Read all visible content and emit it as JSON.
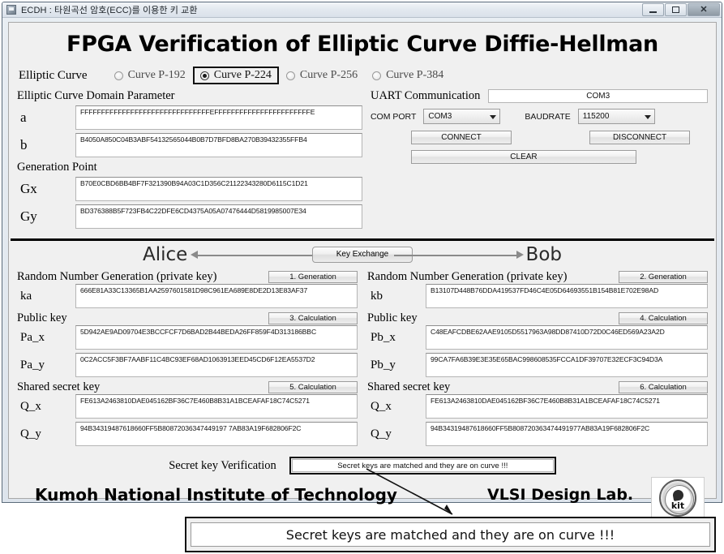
{
  "window": {
    "title": "ECDH : 타원곡선 암호(ECC)를 이용한 키 교환",
    "minimize_label": "",
    "maximize_label": "",
    "close_label": "✕"
  },
  "app": {
    "title": "FPGA Verification of Elliptic Curve Diffie-Hellman"
  },
  "curve_selector": {
    "label": "Elliptic Curve",
    "options": [
      {
        "label": "Curve P-192",
        "selected": false
      },
      {
        "label": "Curve P-224",
        "selected": true
      },
      {
        "label": "Curve P-256",
        "selected": false
      },
      {
        "label": "Curve P-384",
        "selected": false
      }
    ]
  },
  "domain_parameter": {
    "title": "Elliptic Curve Domain Parameter",
    "a_label": "a",
    "a_value": "FFFFFFFFFFFFFFFFFFFFFFFFFFFFFFFEFFFFFFFFFFFFFFFFFFFFFFFE",
    "b_label": "b",
    "b_value": "B4050A850C04B3ABF54132565044B0B7D7BFD8BA270B39432355FFB4"
  },
  "generation_point": {
    "title": "Generation Point",
    "gx_label": "Gx",
    "gx_value": "B70E0CBD6BB4BF7F321390B94A03C1D356C21122343280D6115C1D21",
    "gy_label": "Gy",
    "gy_value": "BD376388B5F723FB4C22DFE6CD4375A05A07476444D5819985007E34"
  },
  "uart": {
    "title": "UART Communication",
    "display_value": "COM3",
    "com_port_label": "COM PORT",
    "com_port_value": "COM3",
    "baudrate_label": "BAUDRATE",
    "baudrate_value": "115200",
    "connect_label": "CONNECT",
    "disconnect_label": "DISCONNECT",
    "clear_label": "CLEAR"
  },
  "exchange_bar": {
    "alice_label": "Alice",
    "bob_label": "Bob",
    "key_exchange_label": "Key Exchange"
  },
  "alice": {
    "private": {
      "title": "Random Number Generation (private key)",
      "button_label": "1. Generation",
      "key_label": "ka",
      "key_value": "666E81A33C13365B1AA2597601581D98C961EA689E8DE2D13E83AF37"
    },
    "public": {
      "title": "Public key",
      "button_label": "3. Calculation",
      "x_label": "Pa_x",
      "x_value": "5D942AE9AD09704E3BCCFCF7D6BAD2B44BEDA26FF859F4D313186BBC",
      "y_label": "Pa_y",
      "y_value": "0C2ACC5F3BF7AABF11C4BC93EF68AD1063913EED45CD6F12EA5537D2"
    },
    "shared": {
      "title": "Shared secret key",
      "button_label": "5. Calculation",
      "x_label": "Q_x",
      "x_value": "FE613A2463810DAE045162BF36C7E460B8B31A1BCEAFAF18C74C5271",
      "y_label": "Q_y",
      "y_value": "94B34319487618660FF5B80872036347449197 7AB83A19F682806F2C"
    }
  },
  "bob": {
    "private": {
      "title": "Random Number Generation (private key)",
      "button_label": "2. Generation",
      "key_label": "kb",
      "key_value": "B13107D448B76DDA419537FD46C4E05D64693551B154B81E702E98AD"
    },
    "public": {
      "title": "Public key",
      "button_label": "4. Calculation",
      "x_label": "Pb_x",
      "x_value": "C48EAFCDBE62AAE9105D5517963A98DD87410D72D0C46ED569A23A2D",
      "y_label": "Pb_y",
      "y_value": "99CA7FA6B39E3E35E65BAC998608535FCCA1DF39707E32ECF3C94D3A"
    },
    "shared": {
      "title": "Shared secret key",
      "button_label": "6. Calculation",
      "x_label": "Q_x",
      "x_value": "FE613A2463810DAE045162BF36C7E460B8B31A1BCEAFAF18C74C5271",
      "y_label": "Q_y",
      "y_value": "94B34319487618660FF5B808720363474491977AB83A19F682806F2C"
    }
  },
  "verification": {
    "label": "Secret key Verification",
    "status": "Secret keys are matched and they are on curve !!!"
  },
  "footer": {
    "university": "Kumoh National Institute of Technology",
    "lab": "VLSI Design Lab.",
    "logo_text": "kit"
  },
  "callout": {
    "text": "Secret keys are matched and they are on curve !!!"
  }
}
